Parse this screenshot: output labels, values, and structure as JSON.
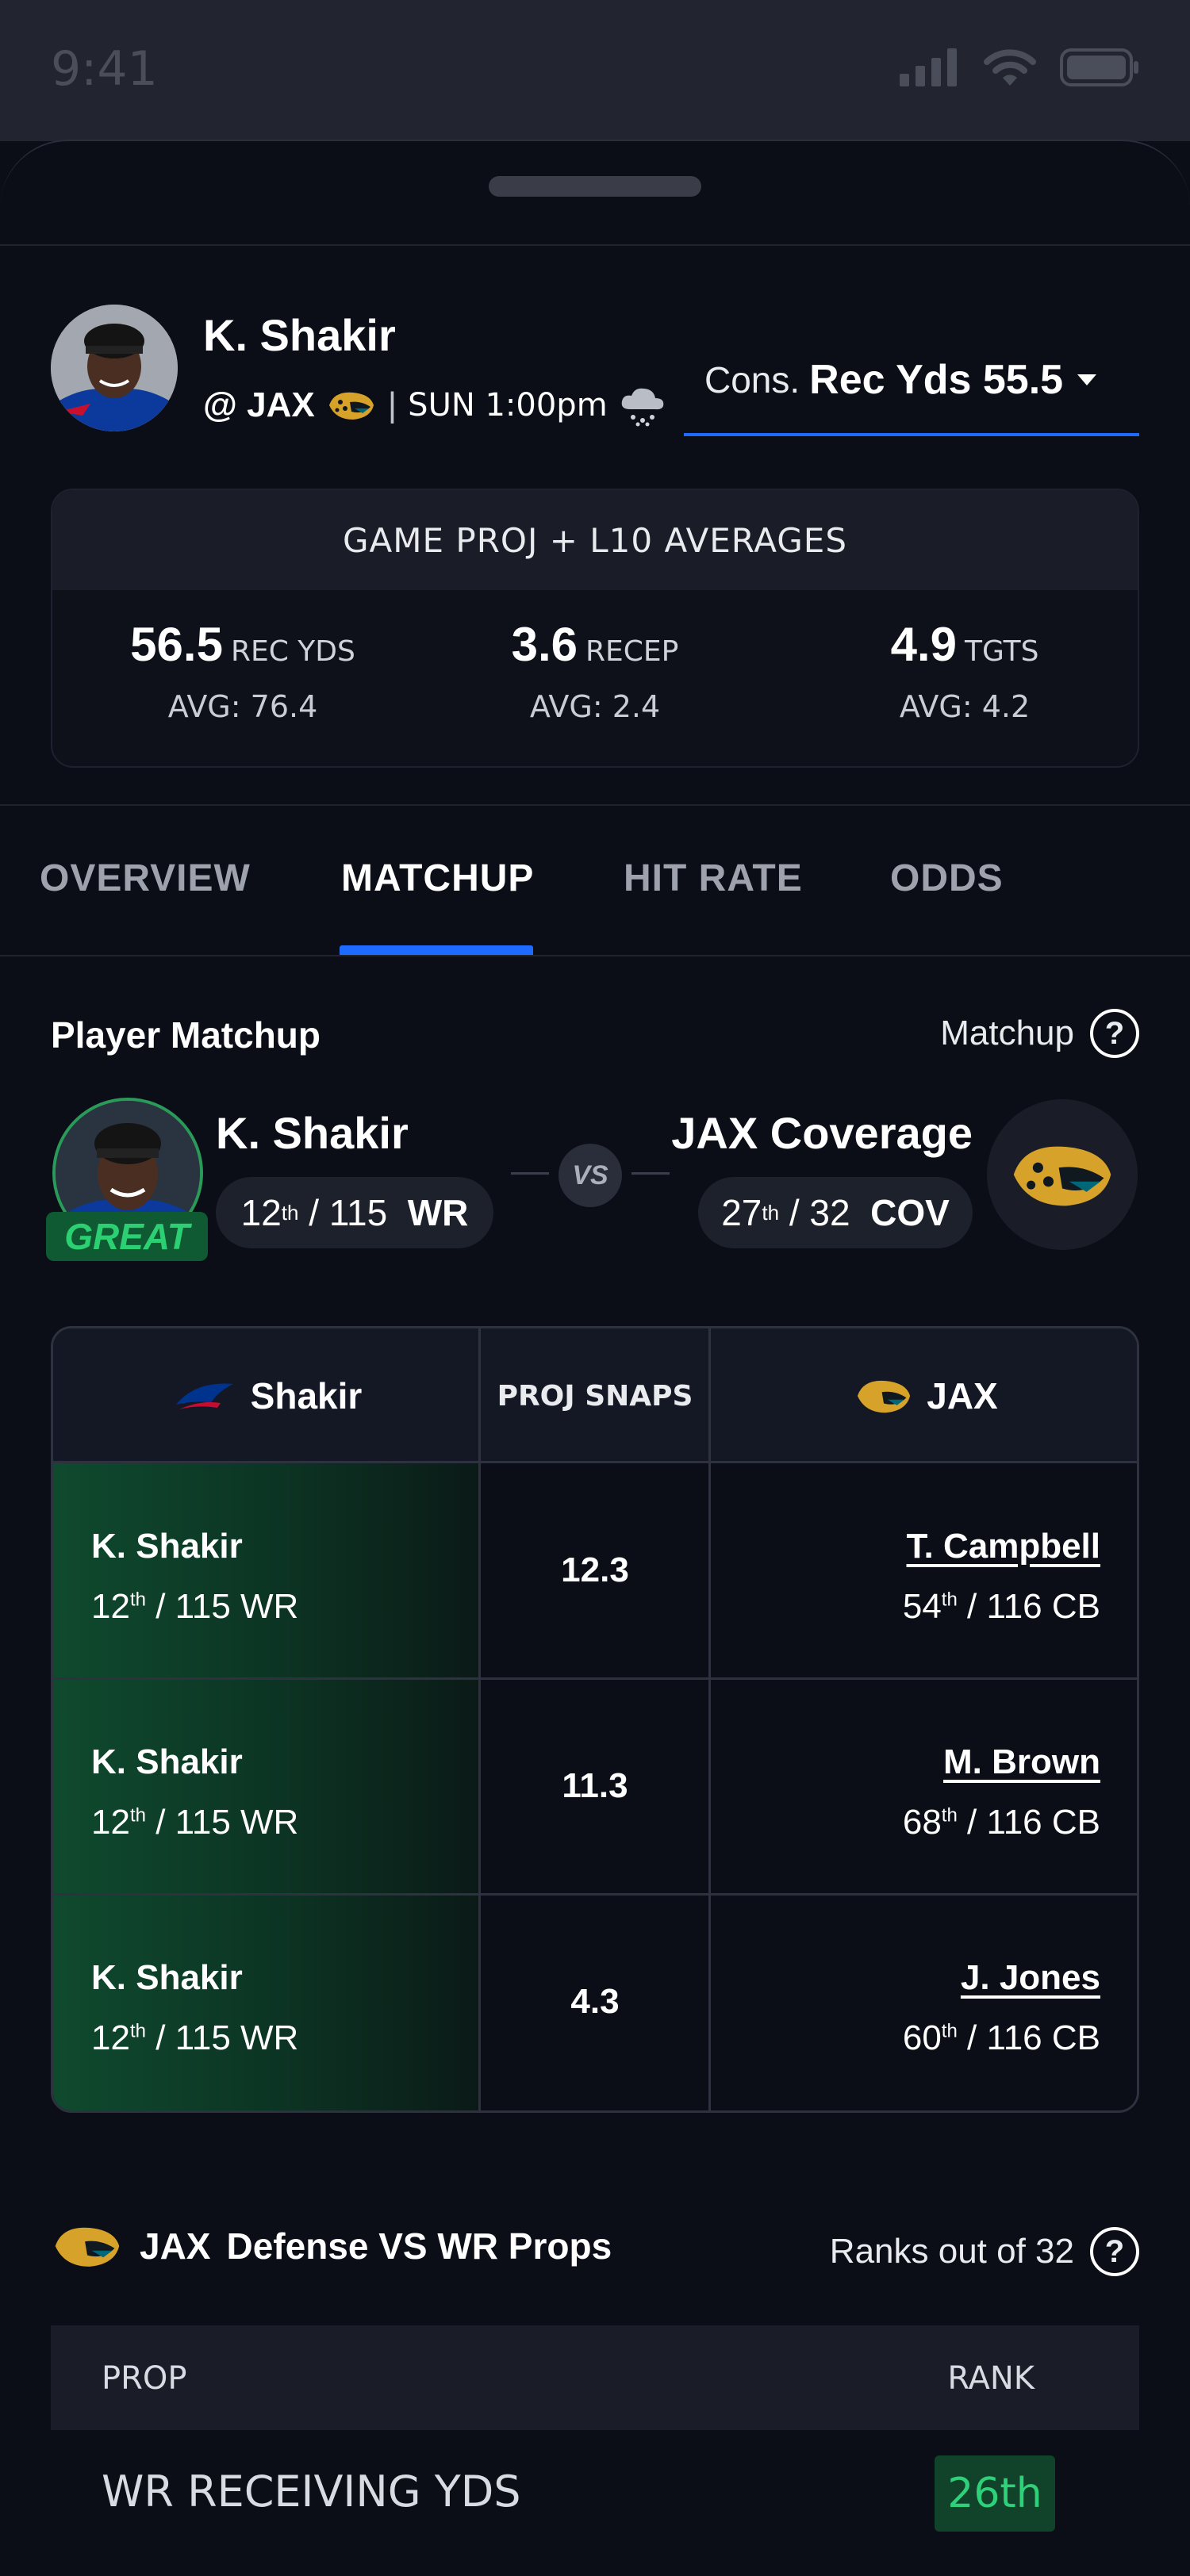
{
  "status_bar": {
    "time": "9:41"
  },
  "header": {
    "player_name": "K. Shakir",
    "opponent": "@ JAX",
    "game_time": "SUN 1:00pm",
    "prop_prefix": "Cons.",
    "prop_value": "Rec Yds 55.5"
  },
  "projections": {
    "title": "GAME PROJ + L10 AVERAGES",
    "stats": [
      {
        "value": "56.5",
        "unit": "REC YDS",
        "avg": "AVG: 76.4"
      },
      {
        "value": "3.6",
        "unit": "RECEP",
        "avg": "AVG: 2.4"
      },
      {
        "value": "4.9",
        "unit": "TGTS",
        "avg": "AVG: 4.2"
      }
    ]
  },
  "tabs": [
    {
      "label": "OVERVIEW",
      "active": false
    },
    {
      "label": "MATCHUP",
      "active": true
    },
    {
      "label": "HIT RATE",
      "active": false
    },
    {
      "label": "ODDS",
      "active": false
    }
  ],
  "matchup": {
    "title": "Player Matchup",
    "right_label": "Matchup",
    "help": "?",
    "badge": "GREAT",
    "vs": "VS",
    "player": {
      "name": "K. Shakir",
      "rank": "12",
      "rank_suffix": "th",
      "rank_total": "/ 115",
      "pos": "WR"
    },
    "defense": {
      "name": "JAX Coverage",
      "rank": "27",
      "rank_suffix": "th",
      "rank_total": "/ 32",
      "pos": "COV"
    }
  },
  "matchup_table": {
    "col_left": "Shakir",
    "col_mid": "PROJ SNAPS",
    "col_right": "JAX",
    "rows": [
      {
        "left_name": "K. Shakir",
        "left_rank": "12",
        "left_suffix": "th",
        "left_rest": "/ 115 WR",
        "snaps": "12.3",
        "right_name": "T. Campbell",
        "right_rank": "54",
        "right_suffix": "th",
        "right_rest": "/ 116 CB"
      },
      {
        "left_name": "K. Shakir",
        "left_rank": "12",
        "left_suffix": "th",
        "left_rest": "/ 115 WR",
        "snaps": "11.3",
        "right_name": "M. Brown",
        "right_rank": "68",
        "right_suffix": "th",
        "right_rest": "/ 116 CB"
      },
      {
        "left_name": "K. Shakir",
        "left_rank": "12",
        "left_suffix": "th",
        "left_rest": "/ 115 WR",
        "snaps": "4.3",
        "right_name": "J. Jones",
        "right_rank": "60",
        "right_suffix": "th",
        "right_rest": "/ 116 CB"
      }
    ]
  },
  "defense_props": {
    "title_team": "JAX",
    "title_rest": "Defense VS WR Props",
    "right_label": "Ranks out of 32",
    "help": "?",
    "col_prop": "PROP",
    "col_rank": "RANK",
    "rows": [
      {
        "prop": "WR RECEIVING YDS",
        "rank": "26th"
      }
    ]
  },
  "colors": {
    "accent": "#1f6bff",
    "great": "#2ccf72",
    "background": "#0b0e17"
  }
}
